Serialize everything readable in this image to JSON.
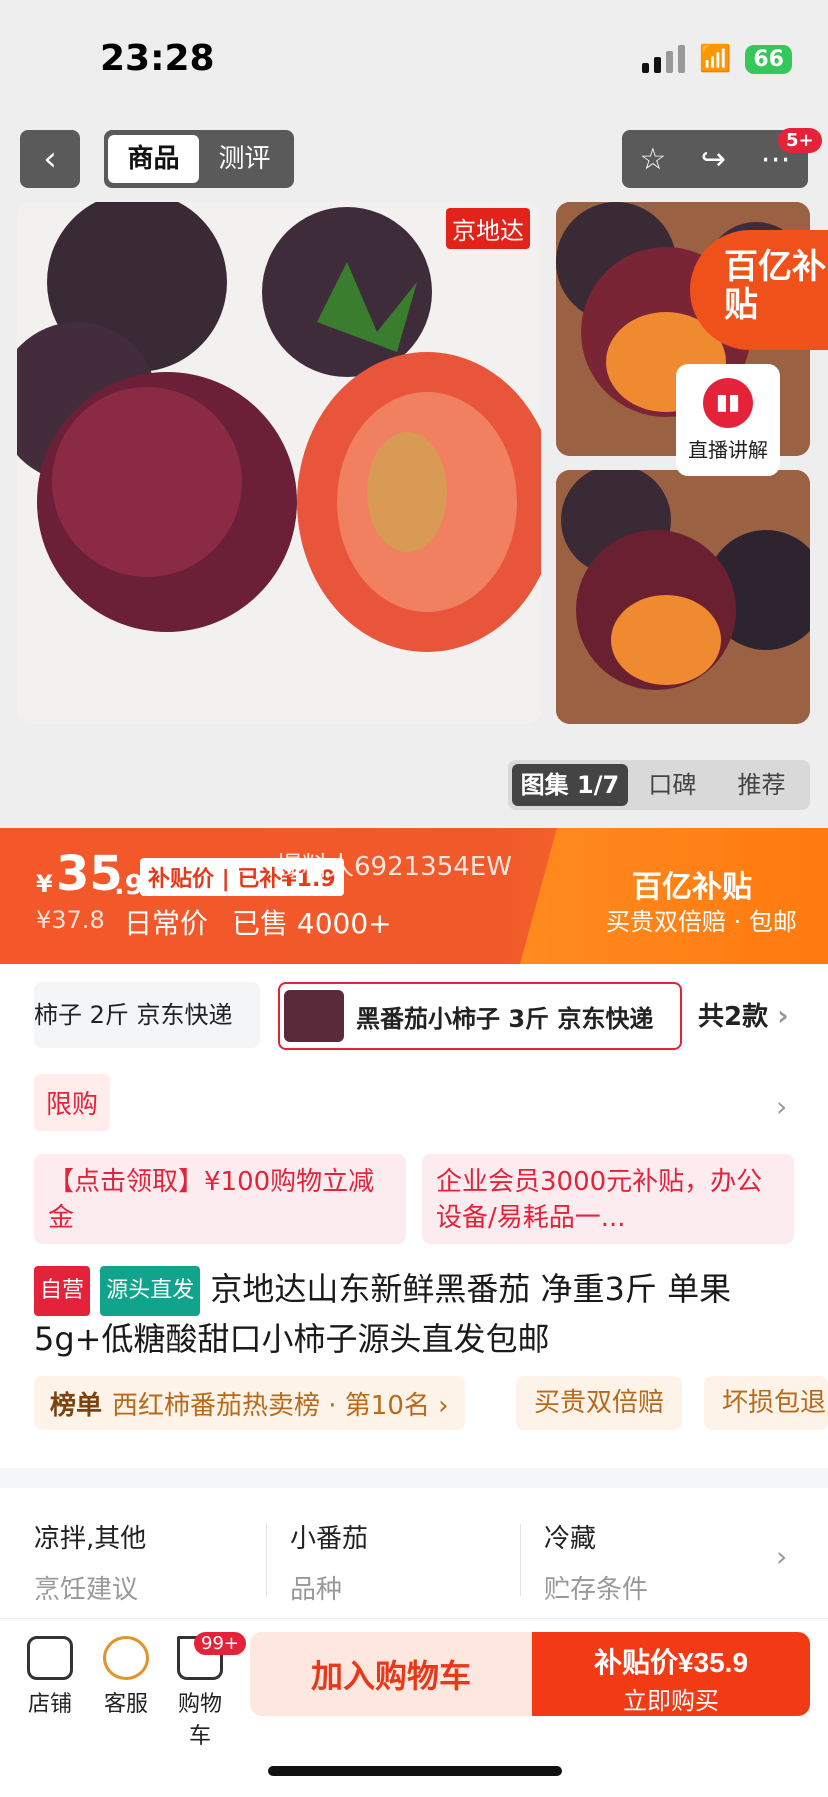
{
  "status_bar": {
    "time": "23:28",
    "battery": "66"
  },
  "nav": {
    "back_icon": "chevron-left",
    "tabs": [
      "商品",
      "测评"
    ],
    "active_tab": "商品",
    "badge": "5+"
  },
  "gallery": {
    "brand_tag": "京地达",
    "subsidy_badge": "百亿补贴",
    "live_label": "直播讲解",
    "segments": [
      "图集 1/7",
      "口碑",
      "推荐"
    ]
  },
  "price": {
    "currency": "¥",
    "integer": "35",
    "decimal": ".9",
    "subsidy_tag": "补贴价 | 已补¥1.9",
    "old_price": "¥37.8",
    "daily_label": "日常价",
    "sold": "已售 4000+",
    "reporter": "爆料人6921354EW",
    "subsidy_title": "百亿补贴",
    "subsidy_sub": "买贵双倍赔 · 包邮"
  },
  "variants": {
    "items": [
      "柿子 2斤 京东快递",
      "黑番茄小柿子 3斤 京东快递"
    ],
    "count": "共2款"
  },
  "limit_tag": "限购",
  "coupons": [
    "【点击领取】¥100购物立减金",
    "企业会员3000元补贴，办公设备/易耗品一..."
  ],
  "product": {
    "tag_self": "自营",
    "tag_source": "源头直发",
    "title": "京地达山东新鲜黑番茄 净重3斤 单果5g+低糖酸甜口小柿子源头直发包邮"
  },
  "rank": {
    "label": "榜单",
    "text": "西红柿番茄热卖榜 · 第10名 ›"
  },
  "pills": [
    "买贵双倍赔",
    "坏损包退"
  ],
  "attributes": [
    {
      "value": "凉拌,其他",
      "key": "烹饪建议"
    },
    {
      "value": "小番茄",
      "key": "品种"
    },
    {
      "value": "冷藏",
      "key": "贮存条件"
    }
  ],
  "bottom_bar": {
    "store": "店铺",
    "service": "客服",
    "cart": "购物车",
    "cart_badge": "99+",
    "add_cart": "加入购物车",
    "buy_price": "补贴价¥35.9",
    "buy_now": "立即购买"
  }
}
